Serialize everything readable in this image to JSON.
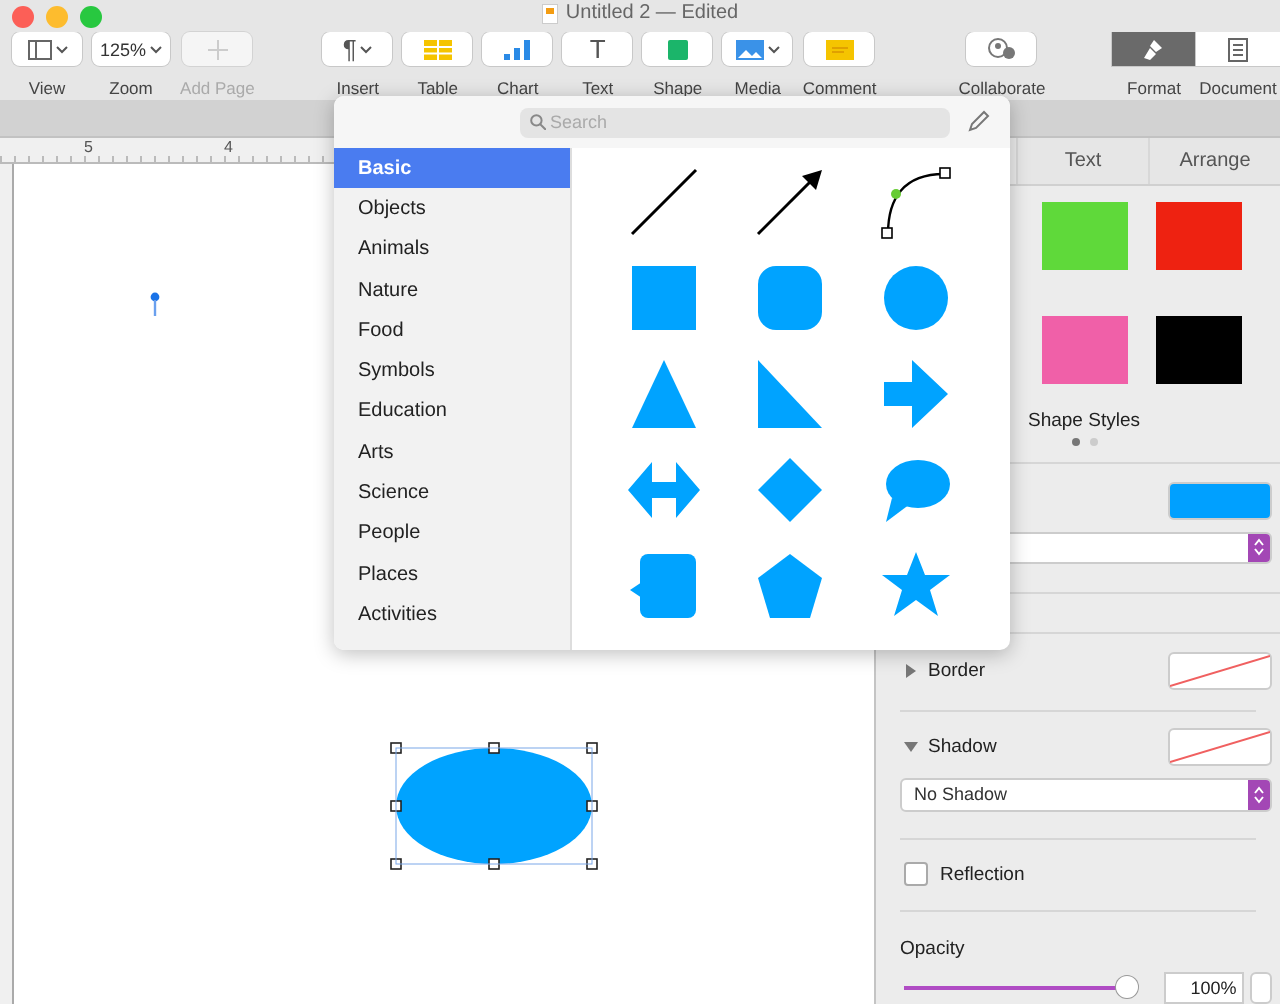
{
  "window": {
    "title": "Untitled 2 — Edited"
  },
  "toolbar": {
    "groups": [
      {
        "items": [
          {
            "label": "View",
            "kind": "view",
            "menu": true,
            "disabled": false
          },
          {
            "label": "Zoom",
            "kind": "zoom",
            "value": "125%",
            "menu": true,
            "disabled": false
          },
          {
            "label": "Add Page",
            "kind": "add",
            "menu": false,
            "disabled": true
          }
        ]
      },
      {
        "items": [
          {
            "label": "Insert",
            "kind": "insert",
            "symbol": "¶",
            "menu": true,
            "disabled": false
          },
          {
            "label": "Table",
            "kind": "table",
            "menu": false,
            "disabled": false
          },
          {
            "label": "Chart",
            "kind": "chart",
            "menu": false,
            "disabled": false
          },
          {
            "label": "Text",
            "kind": "text",
            "symbol": "T",
            "menu": false,
            "disabled": false
          },
          {
            "label": "Shape",
            "kind": "shape",
            "menu": false,
            "disabled": false
          },
          {
            "label": "Media",
            "kind": "media",
            "menu": true,
            "disabled": false
          },
          {
            "label": "Comment",
            "kind": "comment",
            "menu": false,
            "disabled": false
          }
        ]
      },
      {
        "items": [
          {
            "label": "Collaborate",
            "kind": "collaborate",
            "menu": false,
            "disabled": false
          }
        ]
      }
    ],
    "view_switch": [
      {
        "label": "Format",
        "kind": "format",
        "selected": true
      },
      {
        "label": "Document",
        "kind": "document",
        "selected": false
      }
    ]
  },
  "ruler": {
    "marks": [
      "5",
      "4"
    ]
  },
  "canvas": {
    "shape": {
      "kind": "ellipse",
      "selected": true
    }
  },
  "shape_picker": {
    "search": {
      "placeholder": "Search"
    },
    "categories": [
      {
        "label": "Basic",
        "selected": true
      },
      {
        "label": "Objects",
        "selected": false
      },
      {
        "label": "Animals",
        "selected": false
      },
      {
        "label": "Nature",
        "selected": false
      },
      {
        "label": "Food",
        "selected": false
      },
      {
        "label": "Symbols",
        "selected": false
      },
      {
        "label": "Education",
        "selected": false
      },
      {
        "label": "Arts",
        "selected": false
      },
      {
        "label": "Science",
        "selected": false
      },
      {
        "label": "People",
        "selected": false
      },
      {
        "label": "Places",
        "selected": false
      },
      {
        "label": "Activities",
        "selected": false
      }
    ],
    "shapes": [
      {
        "kind": "line"
      },
      {
        "kind": "arrow"
      },
      {
        "kind": "curve"
      },
      {
        "kind": "square"
      },
      {
        "kind": "rounded-square"
      },
      {
        "kind": "circle"
      },
      {
        "kind": "triangle"
      },
      {
        "kind": "right-triangle"
      },
      {
        "kind": "arrow-right"
      },
      {
        "kind": "double-arrow"
      },
      {
        "kind": "diamond"
      },
      {
        "kind": "speech-bubble"
      },
      {
        "kind": "callout-square"
      },
      {
        "kind": "pentagon"
      },
      {
        "kind": "star"
      }
    ]
  },
  "inspector": {
    "tabs": [
      {
        "label": "Text",
        "selected": false
      },
      {
        "label": "Arrange",
        "selected": false
      }
    ],
    "styles": [
      {
        "color": "#5fd93a"
      },
      {
        "color": "#ee2211"
      },
      {
        "color": "#f060a8"
      },
      {
        "color": "#000000"
      }
    ],
    "styles_label": "Shape Styles",
    "style_pages": [
      {
        "selected": true
      },
      {
        "selected": false
      }
    ],
    "fill": {
      "color": "#00a0ff"
    },
    "border": {
      "label": "Border",
      "expanded": false
    },
    "shadow": {
      "label": "Shadow",
      "expanded": true,
      "value": "No Shadow"
    },
    "reflection": {
      "label": "Reflection",
      "checked": false
    },
    "opacity": {
      "label": "Opacity",
      "level": 0.96,
      "value": "100%"
    }
  }
}
